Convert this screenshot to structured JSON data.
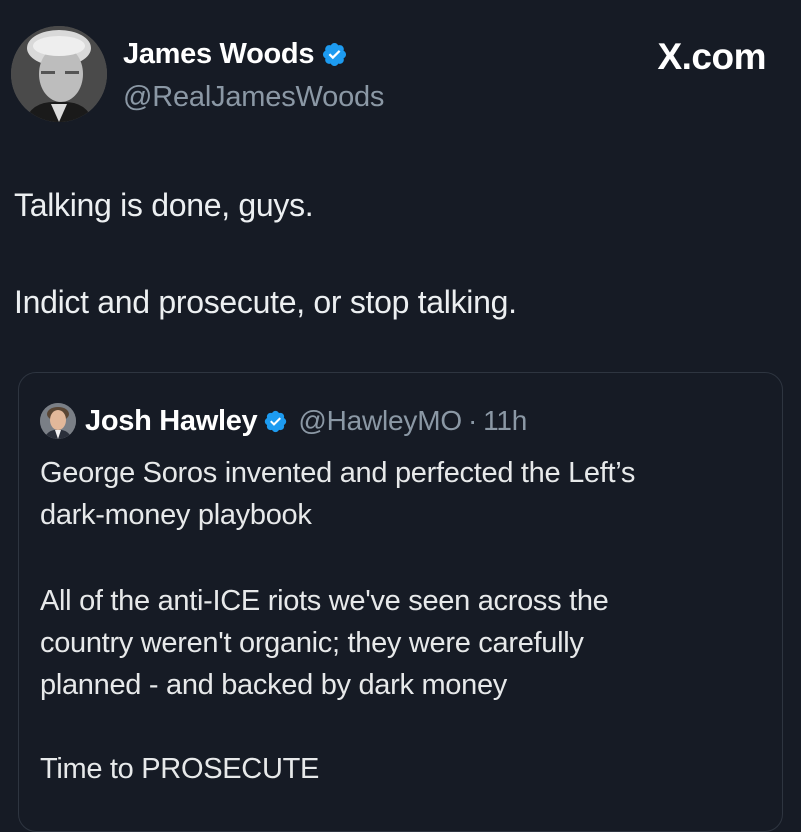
{
  "author": {
    "name": "James Woods",
    "handle": "@RealJamesWoods"
  },
  "brand": "X.com",
  "tweet": {
    "lines": [
      "Talking is done, guys.",
      "Indict and prosecute, or stop talking."
    ]
  },
  "quoted": {
    "name": "Josh Hawley",
    "handle": "@HawleyMO",
    "separator": "·",
    "time": "11h",
    "lines": [
      "George Soros invented and perfected the Left’s",
      "dark-money playbook",
      "All of the anti-ICE riots we've seen across the",
      "country weren't organic; they were carefully",
      "planned - and backed by dark money",
      "Time to PROSECUTE"
    ]
  },
  "colors": {
    "background": "#161b25",
    "verified": "#1d9bf0",
    "secondary_text": "#8b98a5"
  },
  "icons": [
    "verified-badge-icon"
  ]
}
